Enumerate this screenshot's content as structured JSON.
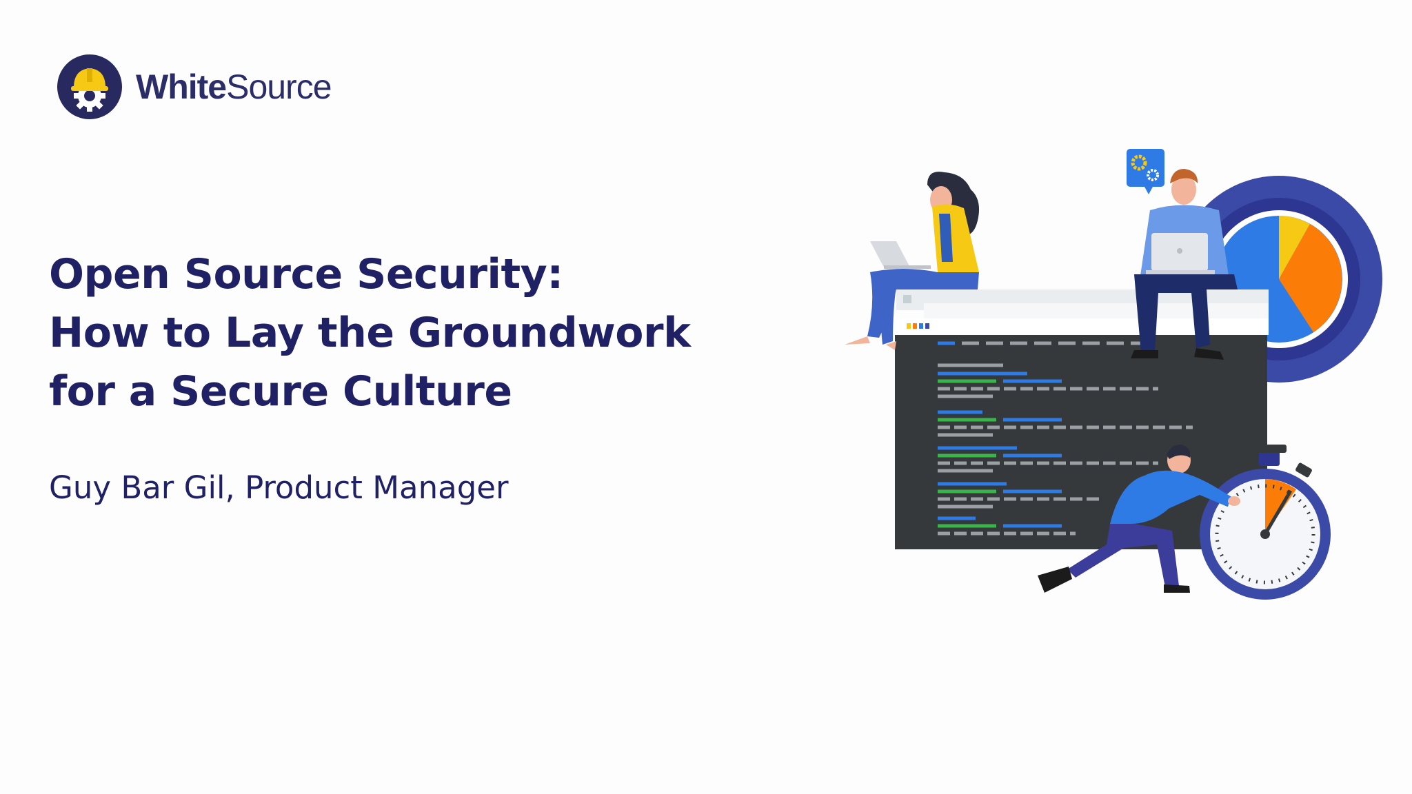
{
  "logo": {
    "name_bold": "White",
    "name_light": "Source"
  },
  "slide": {
    "title_lines": [
      "Open Source Security:",
      "How to Lay the Groundwork",
      "for a Secure Culture"
    ],
    "presenter": "Guy Bar Gil, Product Manager"
  },
  "colors": {
    "navy": "#1f2164",
    "gear": "#3a4aa6",
    "yellow": "#f6c915",
    "orange": "#fb7d08",
    "blue": "#2f7be6",
    "terminal": "#36393c"
  }
}
